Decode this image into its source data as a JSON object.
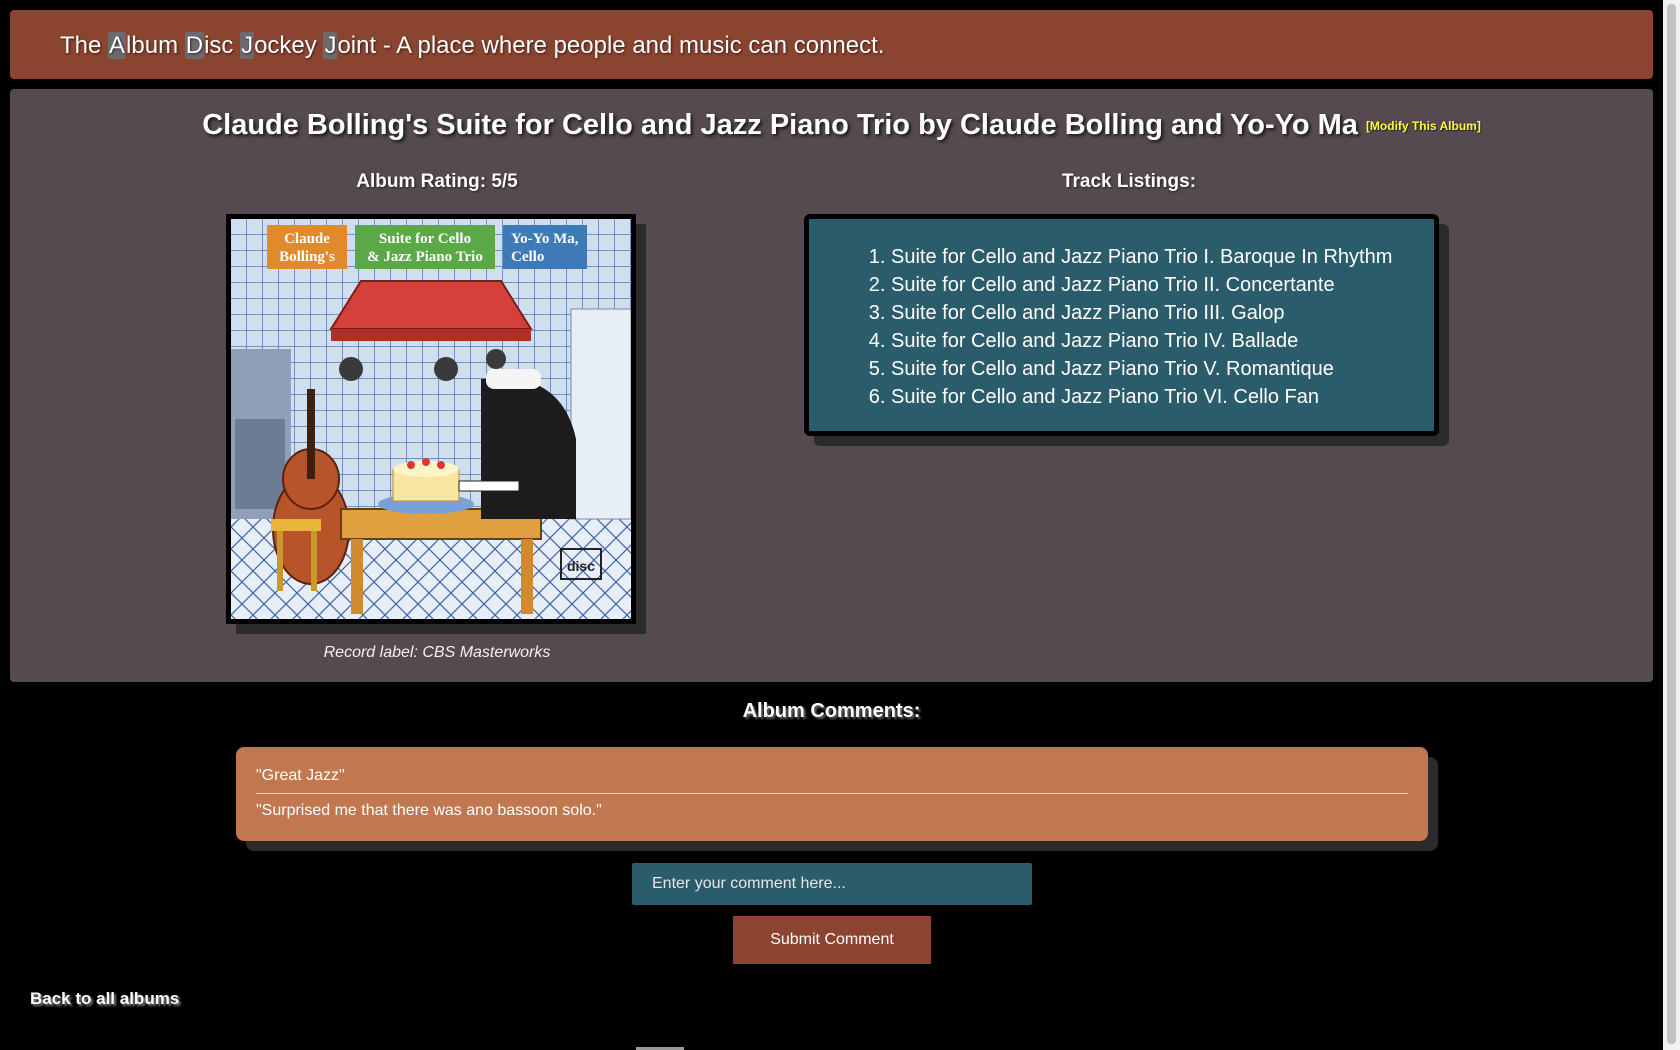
{
  "header": {
    "parts": [
      {
        "text": "The ",
        "initial": false
      },
      {
        "text": "A",
        "initial": true
      },
      {
        "text": "lbum ",
        "initial": false
      },
      {
        "text": "D",
        "initial": true
      },
      {
        "text": "isc ",
        "initial": false
      },
      {
        "text": "J",
        "initial": true
      },
      {
        "text": "ockey ",
        "initial": false
      },
      {
        "text": "J",
        "initial": true
      },
      {
        "text": "oint - A place where people and music can connect.",
        "initial": false
      }
    ]
  },
  "album": {
    "title": "Claude Bolling's Suite for Cello and Jazz Piano Trio by Claude Bolling and Yo-Yo Ma",
    "modify_link": "[Modify This Album]",
    "rating_label": "Album Rating: 5/5",
    "record_label": "Record label: CBS Masterworks",
    "cover": {
      "box1": "Claude Bolling's",
      "box2": "Suite for Cello & Jazz Piano Trio",
      "box3": "Yo-Yo Ma, Cello"
    }
  },
  "tracks": {
    "heading": "Track Listings:",
    "items": [
      "Suite for Cello and Jazz Piano Trio I. Baroque In Rhythm",
      "Suite for Cello and Jazz Piano Trio II. Concertante",
      "Suite for Cello and Jazz Piano Trio III. Galop",
      "Suite for Cello and Jazz Piano Trio IV. Ballade",
      "Suite for Cello and Jazz Piano Trio V. Romantique",
      "Suite for Cello and Jazz Piano Trio VI. Cello Fan"
    ]
  },
  "comments": {
    "heading": "Album Comments:",
    "items": [
      "\"Great Jazz\"",
      "\"Surprised me that there was ano bassoon solo.\""
    ],
    "input_placeholder": "Enter your comment here...",
    "submit_label": "Submit Comment"
  },
  "nav": {
    "back_label": "Back to all albums"
  },
  "colors": {
    "header_bg": "#8b4430",
    "panel_bg": "#544a4f",
    "tracks_bg": "#2b5c6b",
    "comments_bg": "#c17750",
    "modify_link": "#ffff33"
  }
}
